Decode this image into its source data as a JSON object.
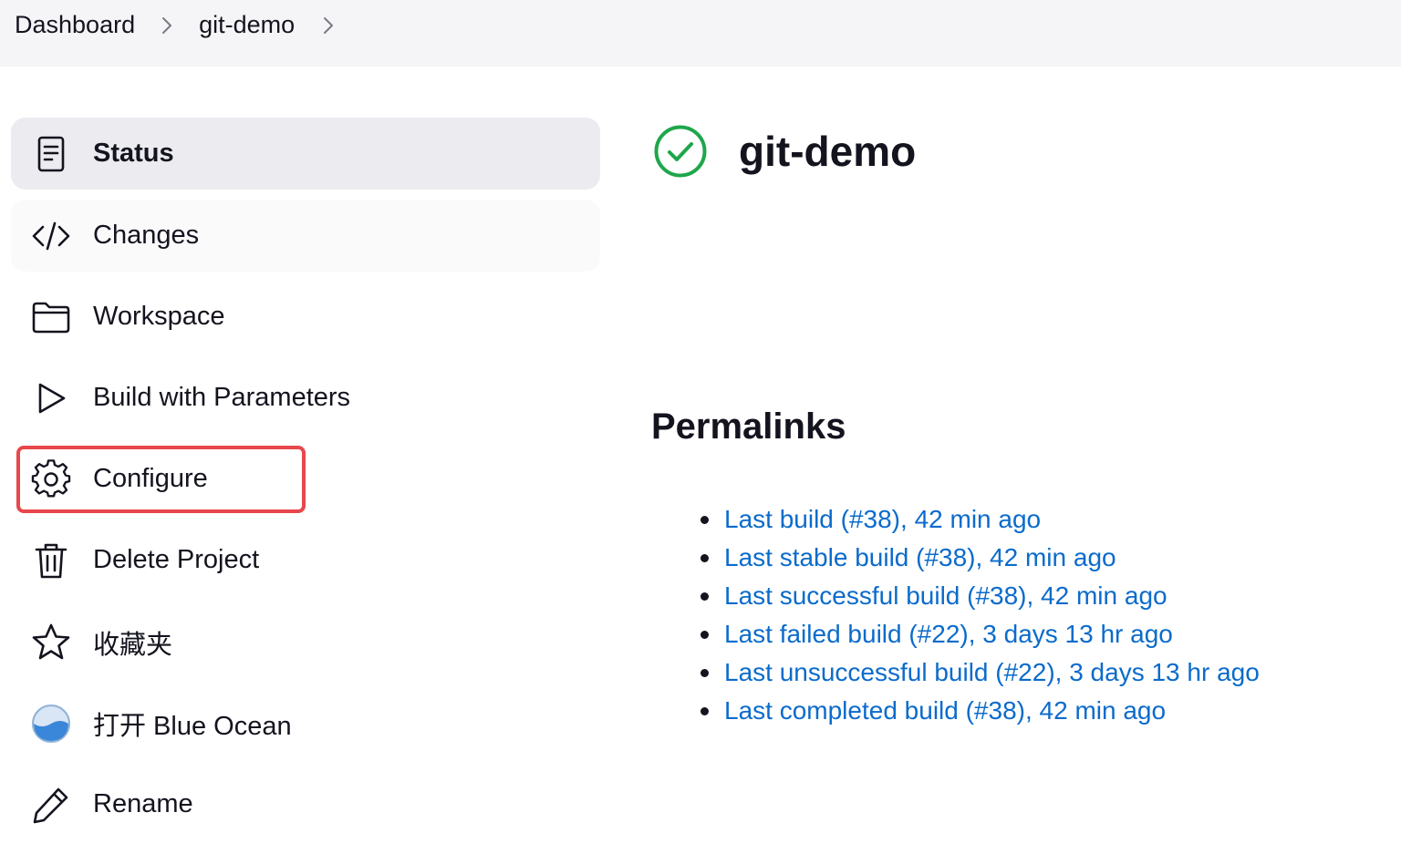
{
  "breadcrumb": {
    "items": [
      {
        "label": "Dashboard"
      },
      {
        "label": "git-demo"
      }
    ]
  },
  "sidebar": {
    "items": [
      {
        "label": "Status",
        "icon": "document-icon"
      },
      {
        "label": "Changes",
        "icon": "code-icon"
      },
      {
        "label": "Workspace",
        "icon": "folder-icon"
      },
      {
        "label": "Build with Parameters",
        "icon": "play-icon"
      },
      {
        "label": "Configure",
        "icon": "gear-icon"
      },
      {
        "label": "Delete Project",
        "icon": "trash-icon"
      },
      {
        "label": "收藏夹",
        "icon": "star-icon"
      },
      {
        "label": "打开 Blue Ocean",
        "icon": "blue-ocean-icon"
      },
      {
        "label": "Rename",
        "icon": "pencil-icon"
      }
    ],
    "active_index": 0
  },
  "main": {
    "title": "git-demo",
    "status_icon": "success-check-icon",
    "permalinks_heading": "Permalinks",
    "permalinks": [
      {
        "label": "Last build (#38), 42 min ago"
      },
      {
        "label": "Last stable build (#38), 42 min ago"
      },
      {
        "label": "Last successful build (#38), 42 min ago"
      },
      {
        "label": "Last failed build (#22), 3 days 13 hr ago"
      },
      {
        "label": "Last unsuccessful build (#22), 3 days 13 hr ago"
      },
      {
        "label": "Last completed build (#38), 42 min ago"
      }
    ]
  },
  "colors": {
    "link": "#0b6bcb",
    "success": "#1ea64b",
    "highlight": "#e8474b",
    "active_bg": "#ebebf0",
    "breadcrumb_bg": "#f5f5f7"
  }
}
